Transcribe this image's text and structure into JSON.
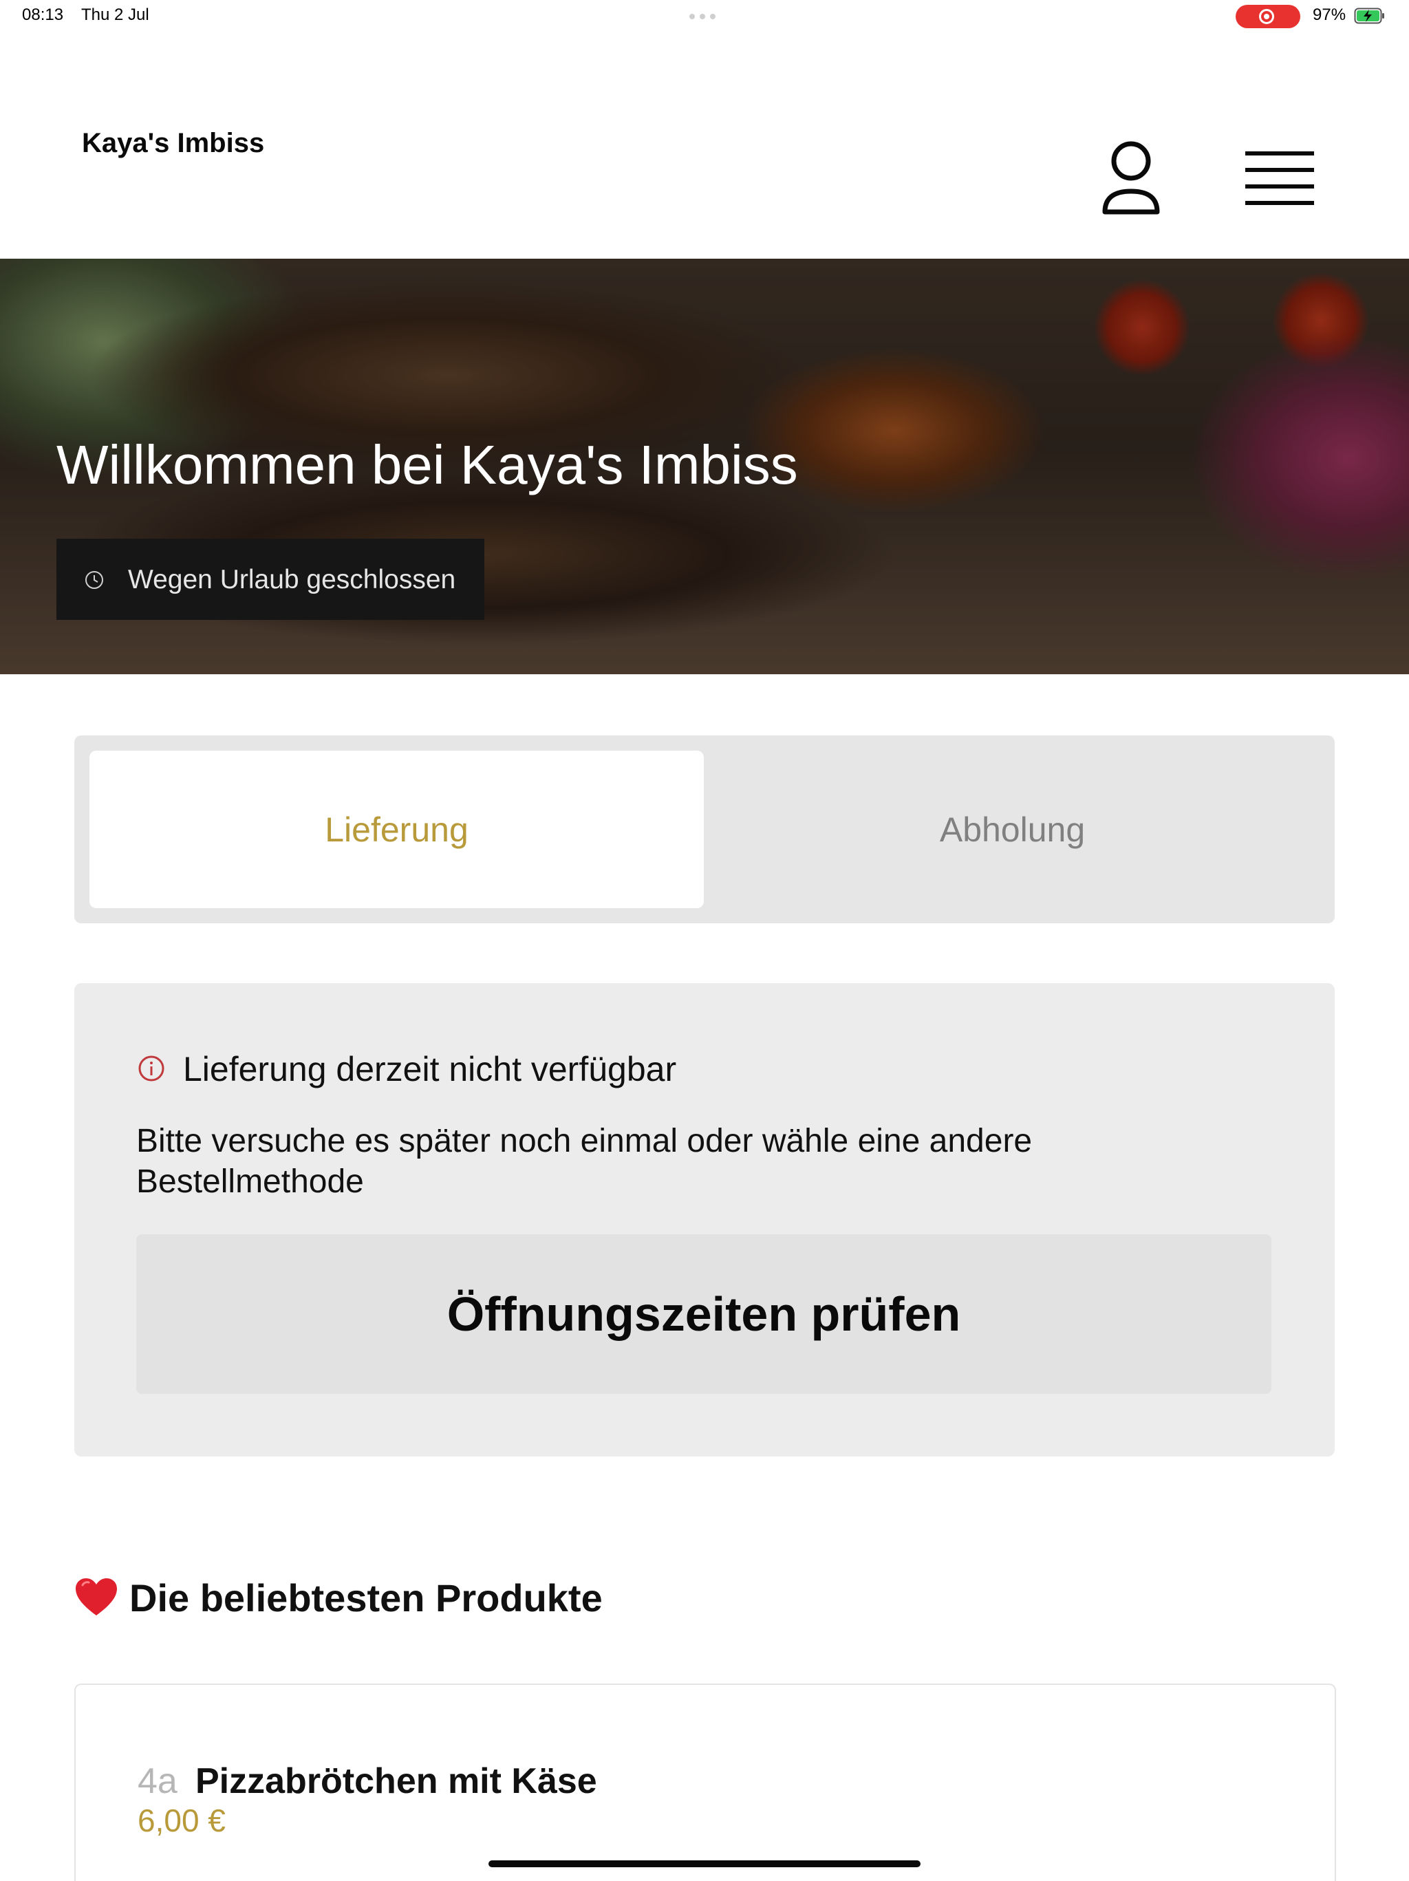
{
  "status_bar": {
    "time": "08:13",
    "date": "Thu 2 Jul",
    "battery_percent": "97%",
    "recording_color": "#e8322f"
  },
  "header": {
    "brand": "Kaya's Imbiss",
    "user_icon": "user-icon",
    "menu_icon": "hamburger-menu-icon"
  },
  "hero": {
    "title": "Willkommen bei Kaya's Imbiss",
    "status_badge": "Wegen Urlaub geschlossen",
    "status_icon": "clock-icon"
  },
  "order_tabs": [
    {
      "label": "Lieferung",
      "active": true
    },
    {
      "label": "Abholung",
      "active": false
    }
  ],
  "notice": {
    "icon": "info-icon",
    "title": "Lieferung derzeit nicht verfügbar",
    "text": "Bitte versuche es später noch einmal oder wähle eine andere Bestellmethode",
    "button": "Öffnungszeiten prüfen"
  },
  "popular": {
    "icon": "heart-icon",
    "title": "Die beliebtesten Produkte",
    "items": [
      {
        "number": "4a",
        "name": "Pizzabrötchen mit Käse",
        "price": "6,00 €"
      }
    ]
  },
  "colors": {
    "accent": "#b89a3a",
    "alert": "#c0393b",
    "panel": "#ececec"
  }
}
